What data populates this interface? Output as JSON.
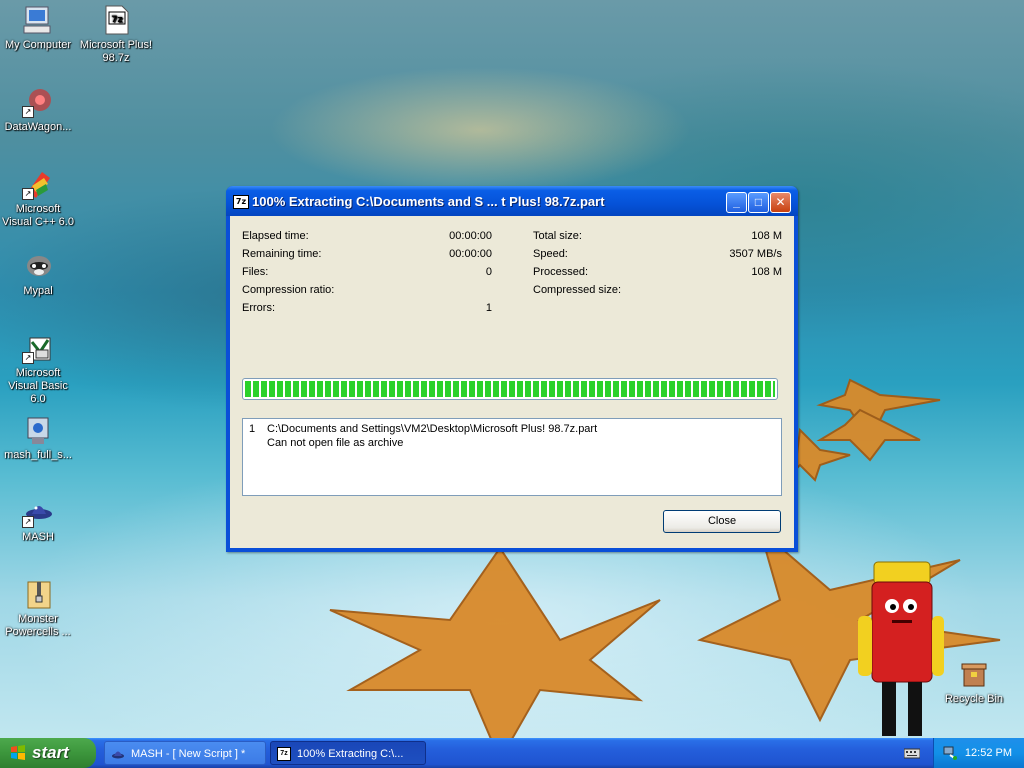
{
  "desktop": {
    "icons": [
      {
        "label": "My Computer"
      },
      {
        "label": "Microsoft Plus! 98.7z"
      },
      {
        "label": "DataWagon..."
      },
      {
        "label": "Microsoft Visual C++ 6.0"
      },
      {
        "label": "Mypal"
      },
      {
        "label": "Microsoft Visual Basic 6.0"
      },
      {
        "label": "mash_full_s..."
      },
      {
        "label": "MASH"
      },
      {
        "label": "Monster Powercells ..."
      },
      {
        "label": "Recycle Bin"
      }
    ]
  },
  "dialog": {
    "app_icon_text": "7z",
    "title": "100% Extracting C:\\Documents and S ... t Plus! 98.7z.part",
    "left_stats": [
      {
        "label": "Elapsed time:",
        "value": "00:00:00"
      },
      {
        "label": "Remaining time:",
        "value": "00:00:00"
      },
      {
        "label": "Files:",
        "value": "0"
      },
      {
        "label": "Compression ratio:",
        "value": ""
      },
      {
        "label": "Errors:",
        "value": "1"
      }
    ],
    "right_stats": [
      {
        "label": "Total size:",
        "value": "108 M"
      },
      {
        "label": "Speed:",
        "value": "3507 MB/s"
      },
      {
        "label": "Processed:",
        "value": "108 M"
      },
      {
        "label": "Compressed size:",
        "value": ""
      }
    ],
    "progress": 1.0,
    "messages": [
      {
        "index": "1",
        "line1": "C:\\Documents and Settings\\VM2\\Desktop\\Microsoft Plus! 98.7z.part",
        "line2": "Can not open file as archive"
      }
    ],
    "close_label": "Close"
  },
  "taskbar": {
    "start_label": "start",
    "tasks": [
      {
        "label": "MASH - [ New Script ] *",
        "active": false
      },
      {
        "label": "100% Extracting C:\\...",
        "active": true
      }
    ],
    "clock": "12:52 PM"
  },
  "colors": {
    "progress_green": "#2bd12b",
    "titlebar_blue": "#0552d8",
    "taskbar_blue": "#245edb",
    "start_green": "#3c963c"
  }
}
